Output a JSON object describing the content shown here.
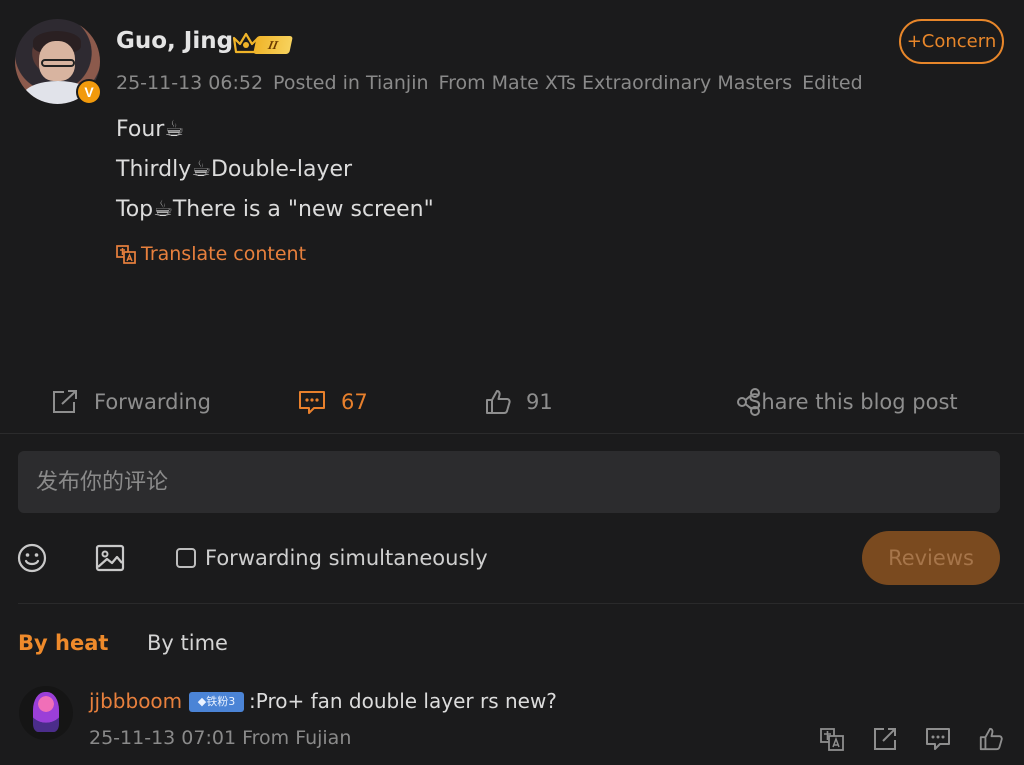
{
  "post": {
    "author": "Guo, Jing",
    "verified_badge": "V",
    "level_badge": "II",
    "timestamp": "25-11-13 06:52",
    "location": "Posted in Tianjin",
    "source": "From Mate XTs Extraordinary Masters",
    "edited": "Edited",
    "follow_label": "+Concern",
    "lines": [
      "Four☕",
      "Thirdly☕Double-layer",
      "Top☕There is a \"new screen\""
    ],
    "translate_label": "Translate content"
  },
  "actions": {
    "forward_label": "Forwarding",
    "comment_count": "67",
    "like_count": "91",
    "share_label": "Share this blog post"
  },
  "composer": {
    "placeholder": "发布你的评论",
    "forward_simultaneously": "Forwarding simultaneously",
    "submit_label": "Reviews"
  },
  "sort_tabs": {
    "heat": "By heat",
    "time": "By time"
  },
  "comments": [
    {
      "user": "jjbbboom",
      "badge": "◆铁粉3",
      "text": ":Pro+ fan double layer rs new?",
      "meta": "25-11-13 07:01 From Fujian"
    }
  ],
  "colors": {
    "background": "#1b1b1c",
    "accent": "#e8803d",
    "muted": "#8a8a8a",
    "badge_blue": "#4b84d6"
  },
  "icons": [
    "verified-icon",
    "crown-icon",
    "translate-icon",
    "forward-icon",
    "comment-icon",
    "like-icon",
    "share-icon",
    "emoji-icon",
    "image-icon"
  ]
}
